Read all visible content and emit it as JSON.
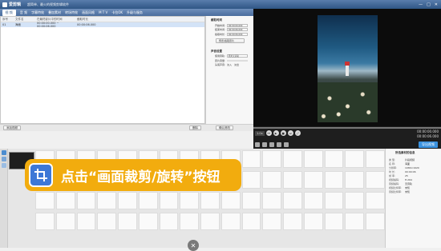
{
  "app": {
    "name": "爱剪辑",
    "subtitle": "超简单、最火的视频剪辑软件",
    "window_controls": [
      "—",
      "□",
      "✕"
    ]
  },
  "menu": {
    "items": [
      "视 频",
      "音 频",
      "字幕特效",
      "叠加素材",
      "转场特效",
      "画面风格",
      "M T V",
      "卡拉OK",
      "升级与服务"
    ]
  },
  "list": {
    "columns": [
      "序号",
      "文件名",
      "在最终影片中的时间",
      "截取时长"
    ],
    "rows": [
      {
        "index": "01",
        "name": "海面",
        "time": "00:00:00.000 ~ 00:00:06.000",
        "duration": "00:00:06.000"
      }
    ]
  },
  "list_footer": {
    "add_label": "添加视频",
    "delete_label": "删除",
    "confirm_label": "确认修改"
  },
  "side_panel": {
    "clip_title": "截取时间",
    "start_label": "开始时间:",
    "start_value": "00:00:00.000",
    "end_label": "结束时间:",
    "end_value": "00:00:06.000",
    "dur_label": "截取时长:",
    "dur_value": "00:00:06.000",
    "preview_button": "预览/截取原片",
    "audio_title": "声音设置",
    "track_label": "使用音轨:",
    "track_value": "原片无音轨",
    "volume_label": "原片音量:",
    "fade_label": "头尾声音:",
    "fade_in": "淡入",
    "fade_out": "淡出"
  },
  "transport": {
    "speed": "1.0x",
    "time_current": "00:00:00.000",
    "time_total": "00:00:06.000",
    "export_label": "导出视频"
  },
  "callout": {
    "text": "点击“画面裁剪/旋转”按钮"
  },
  "info_panel": {
    "title": "所选素材的信息",
    "rows": [
      {
        "k": "类  型:",
        "v": "片段视频"
      },
      {
        "k": "名  称:",
        "v": "海面"
      },
      {
        "k": "分辨率:",
        "v": "1080×1920"
      },
      {
        "k": "时  长:",
        "v": "00:00:06"
      },
      {
        "k": "帧  率:",
        "v": "25"
      },
      {
        "k": "视频编码:",
        "v": "H.264"
      },
      {
        "k": "音频编码:",
        "v": "无音轨"
      },
      {
        "k": "视频比特率:",
        "v": "未知"
      },
      {
        "k": "音频比特率:",
        "v": "未知"
      }
    ]
  },
  "colors": {
    "accent": "#3a92e0",
    "callout": "#f2ac0e",
    "titlebar": "#2f5685"
  }
}
